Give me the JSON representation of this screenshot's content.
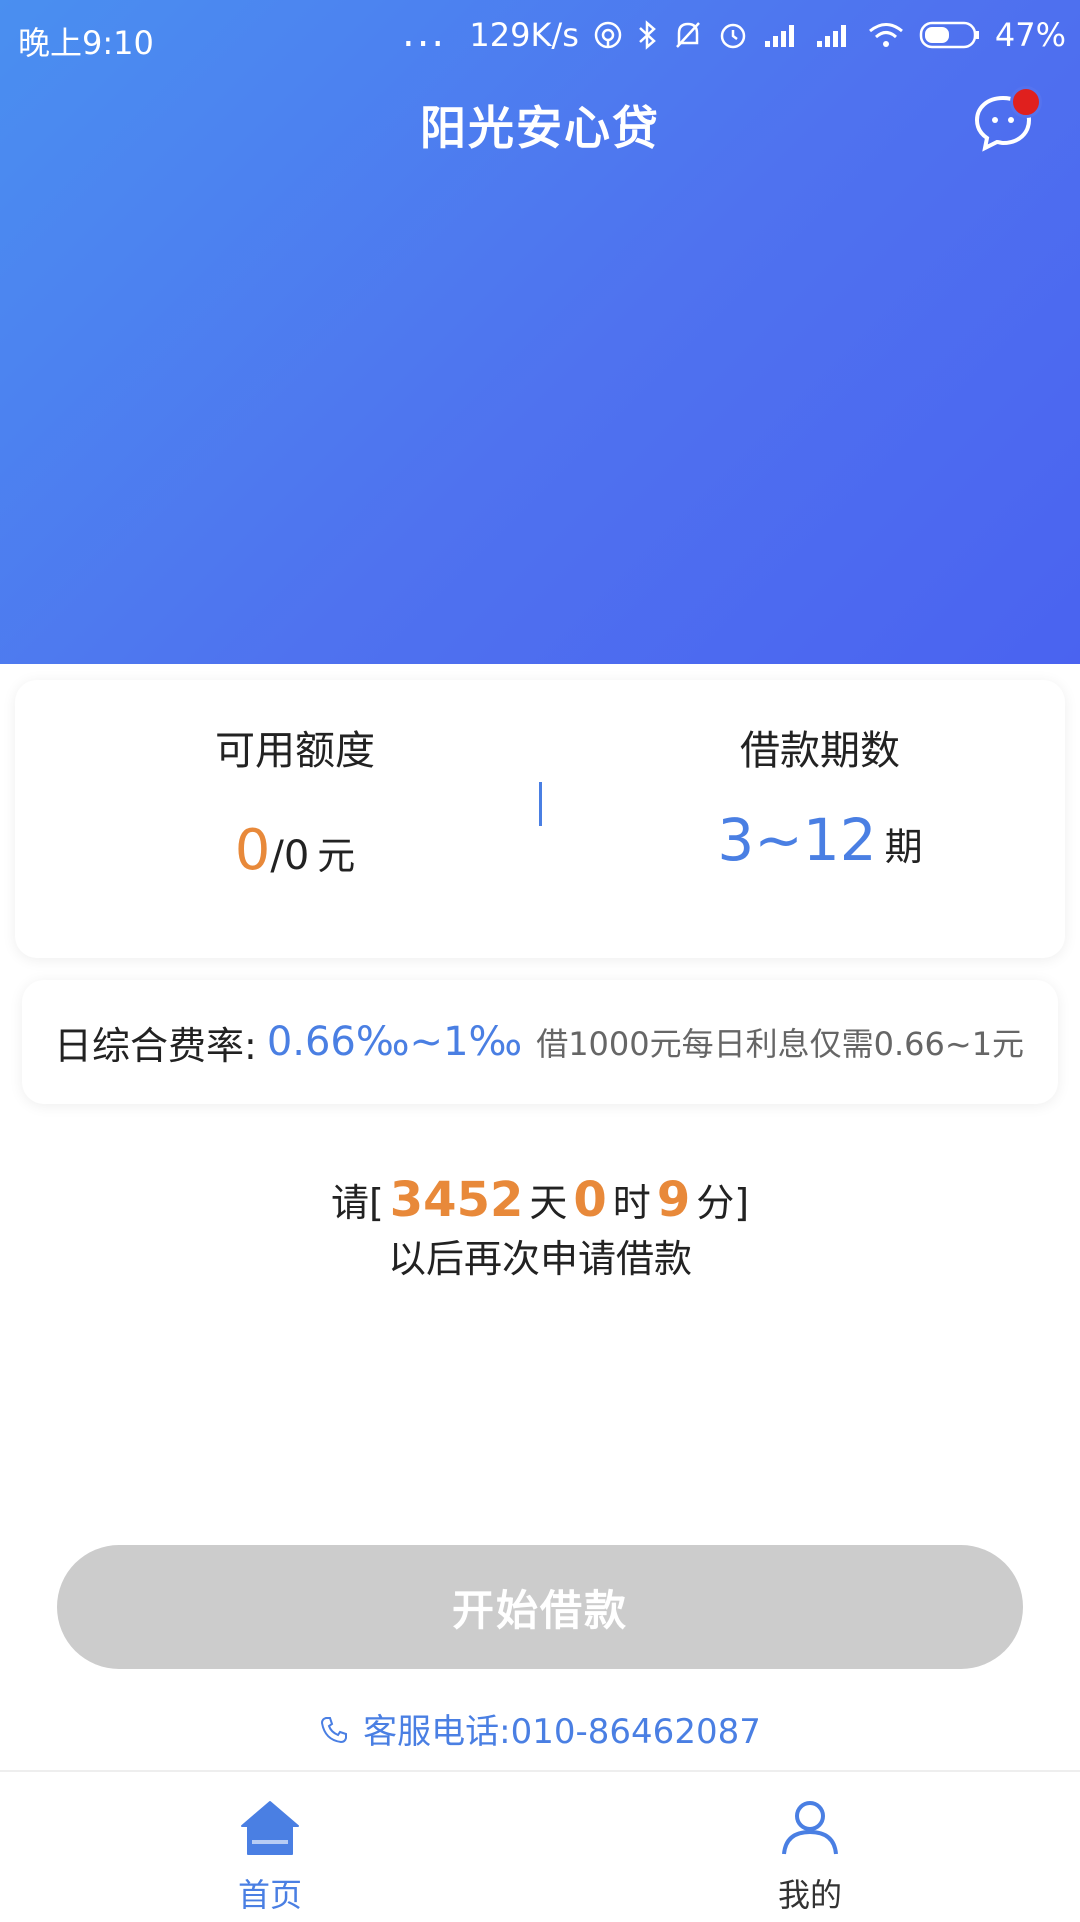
{
  "status_bar": {
    "time": "晚上9:10",
    "dots": "...",
    "speed": "129K/s",
    "battery": "47%"
  },
  "nav": {
    "title": "阳光安心贷"
  },
  "quota_card": {
    "left_label": "可用额度",
    "left_value_available": "0",
    "left_value_total": "/0",
    "left_unit": "元",
    "right_label": "借款期数",
    "right_value": "3~12",
    "right_unit": "期"
  },
  "rate_card": {
    "label": "日综合费率:",
    "value": "0.66‰~1‰",
    "note": "借1000元每日利息仅需0.66~1元"
  },
  "notice": {
    "prefix": "请[",
    "days": "3452",
    "days_unit": "天",
    "hours": "0",
    "hours_unit": "时",
    "minutes": "9",
    "minutes_unit": "分]",
    "line2": "以后再次申请借款"
  },
  "button": {
    "label": "开始借款",
    "state": "disabled"
  },
  "service": {
    "label": "客服电话:",
    "phone": "010-86462087"
  },
  "tabs": [
    {
      "label": "首页",
      "active": true
    },
    {
      "label": "我的",
      "active": false
    }
  ],
  "colors": {
    "brand_blue": "#4a7fe3",
    "accent_orange": "#e8893a",
    "disabled_gray": "#cccccc",
    "badge_red": "#e0201e"
  },
  "icons": [
    "chat-icon",
    "phone-icon",
    "home-icon",
    "user-icon",
    "bluetooth-icon",
    "bell-off-icon",
    "alarm-icon",
    "signal-icon",
    "wifi-icon",
    "battery-icon"
  ]
}
